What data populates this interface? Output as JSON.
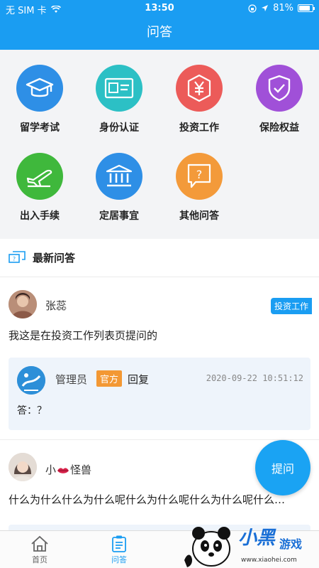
{
  "status_bar": {
    "carrier": "无 SIM 卡",
    "time": "13:50",
    "battery": "81%",
    "battery_level": 0.81
  },
  "navbar": {
    "title": "问答"
  },
  "categories": [
    {
      "label": "留学考试",
      "icon": "graduation-cap-icon",
      "color": "#2e8fe6"
    },
    {
      "label": "身份认证",
      "icon": "id-card-icon",
      "color": "#2cc0c5"
    },
    {
      "label": "投资工作",
      "icon": "yen-icon",
      "color": "#ec5b59"
    },
    {
      "label": "保险权益",
      "icon": "shield-check-icon",
      "color": "#a050d8"
    },
    {
      "label": "出入手续",
      "icon": "airplane-icon",
      "color": "#3fb83c"
    },
    {
      "label": "定居事宜",
      "icon": "bank-icon",
      "color": "#2e8fe6"
    },
    {
      "label": "其他问答",
      "icon": "question-bubble-icon",
      "color": "#f39a3a"
    }
  ],
  "section": {
    "title": "最新问答"
  },
  "posts": [
    {
      "user": "张蕊",
      "tag": "投资工作",
      "question": "我这是在投资工作列表页提问的",
      "reply": {
        "name": "管理员",
        "badge": "官方",
        "label": "回复",
        "time": "2020-09-22 10:51:12",
        "answer": "答：？"
      }
    },
    {
      "user_prefix": "小",
      "user_suffix": "怪兽",
      "question": "什么为什么什么为什么呢什么为什么呢什么为什么呢什么…"
    }
  ],
  "fab": {
    "label": "提问"
  },
  "tabbar": {
    "home": "首页",
    "qa": "问答"
  },
  "watermark": {
    "brand_a": "小黑",
    "brand_b": "游戏",
    "url": "www.xiaohei.com"
  },
  "colors": {
    "accent": "#1a9df2",
    "official_badge": "#f39834",
    "reply_bg": "#eef4fb"
  }
}
